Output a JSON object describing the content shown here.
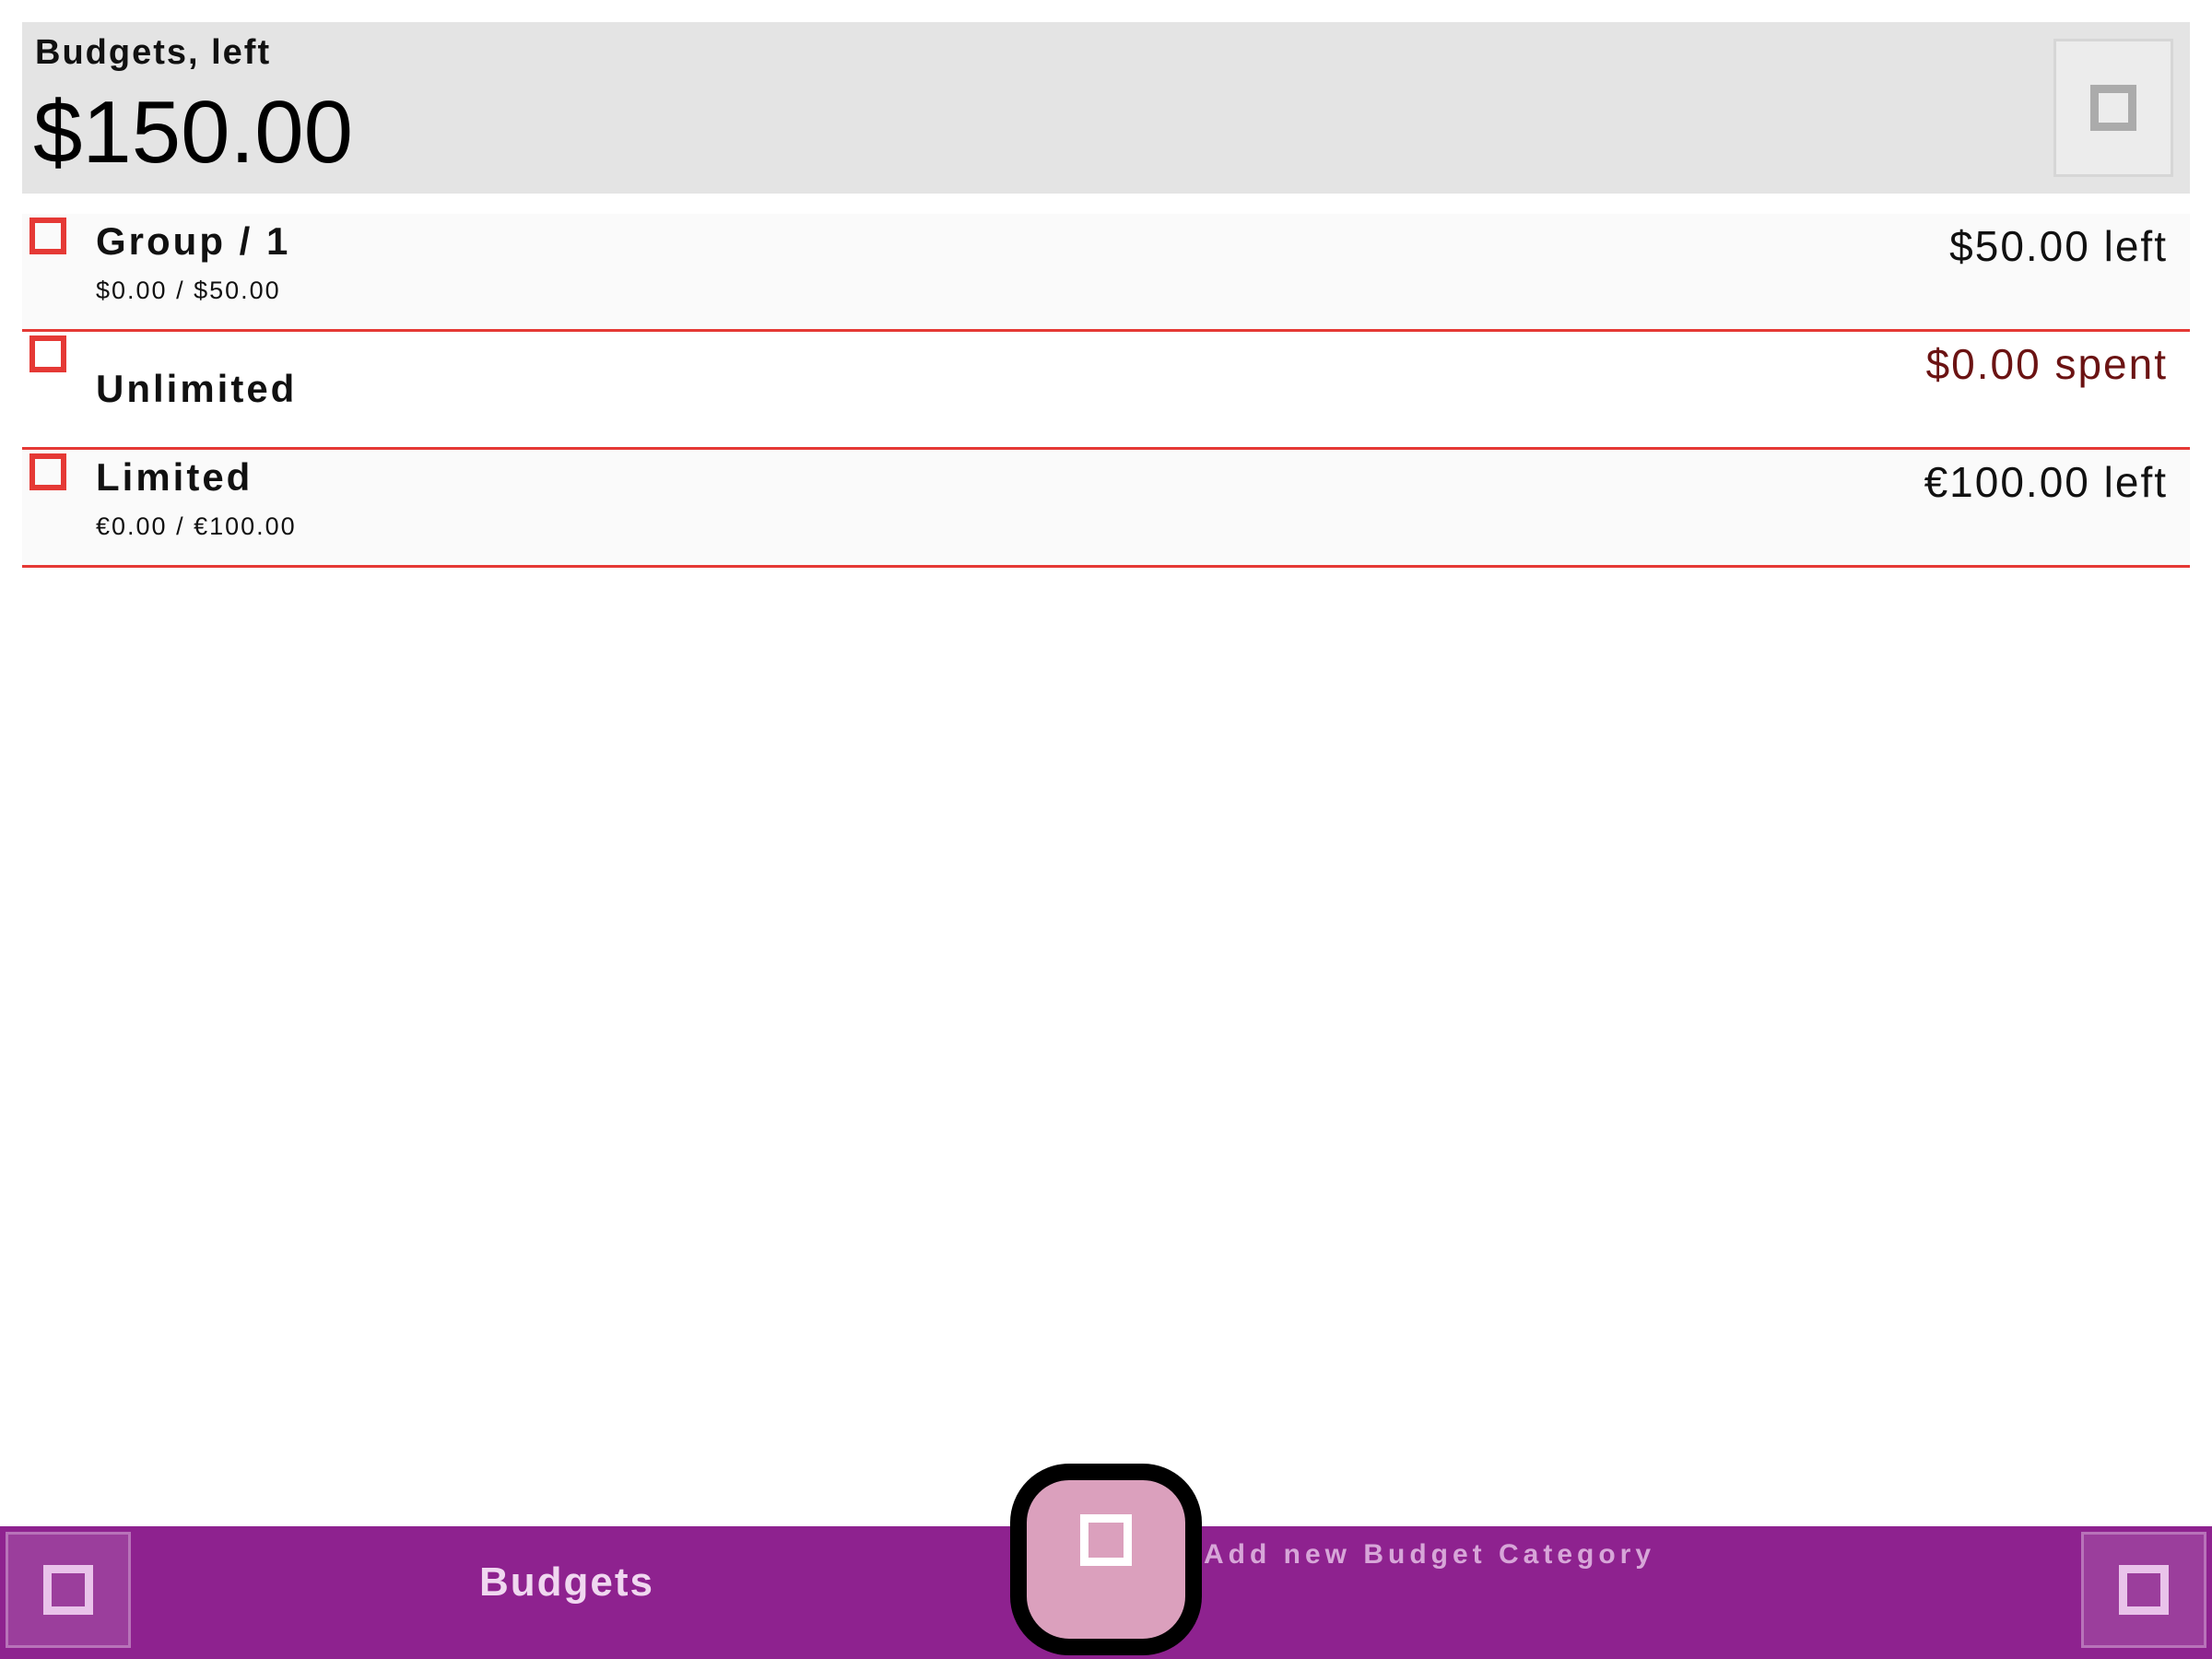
{
  "header": {
    "caption": "Budgets, left",
    "amount": "$150.00",
    "action_icon": "square-icon"
  },
  "budgets": [
    {
      "name": "Group / 1",
      "subtitle": "$0.00 / $50.00",
      "status": "$50.00 left",
      "icon": "square-icon"
    },
    {
      "name": "Unlimited",
      "subtitle": "",
      "status": "$0.00 spent",
      "icon": "square-icon",
      "status_color": "#6b1313"
    },
    {
      "name": "Limited",
      "subtitle": "€0.00 / €100.00",
      "status": "€100.00 left",
      "icon": "square-icon"
    }
  ],
  "bottom_bar": {
    "title": "Budgets",
    "fab_label": "Add new Budget Category",
    "left_icon": "square-icon",
    "right_icon": "square-icon",
    "fab_icon": "square-icon"
  },
  "colors": {
    "accent": "#8e228f",
    "row_border": "#e53935",
    "fab": "#dba0bd"
  }
}
